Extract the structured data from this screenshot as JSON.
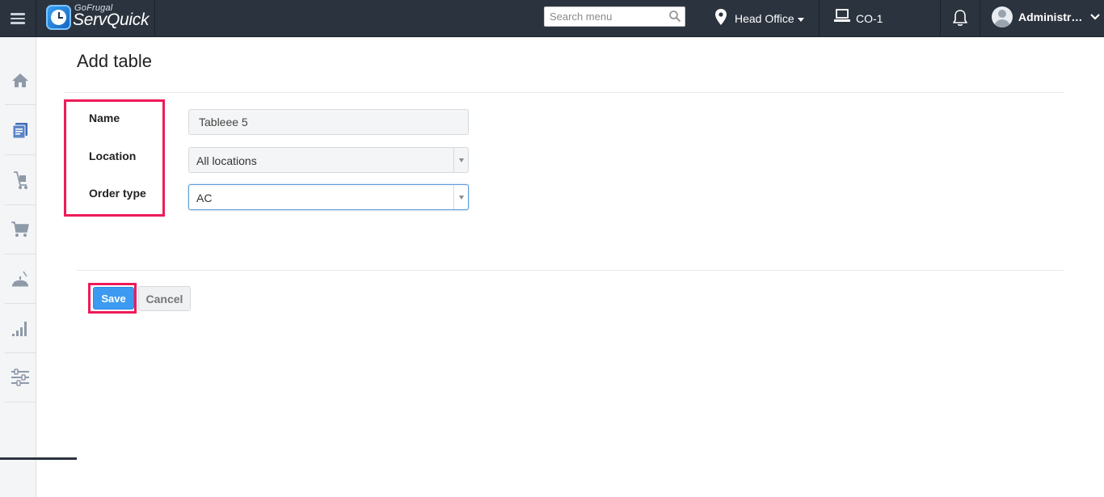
{
  "header": {
    "brand_small": "GoFrugal",
    "brand_name": "ServQuick",
    "search_placeholder": "Search menu",
    "location_label": "Head Office",
    "counter_label": "CO-1",
    "user_label": "Administrator",
    "overflow_dots": "..."
  },
  "sidebar": {
    "items": [
      {
        "icon": "home-icon"
      },
      {
        "icon": "catalog-icon"
      },
      {
        "icon": "inventory-cart-icon"
      },
      {
        "icon": "shopping-cart-icon"
      },
      {
        "icon": "restaurant-icon"
      },
      {
        "icon": "reports-signal-icon"
      },
      {
        "icon": "settings-sliders-icon"
      }
    ]
  },
  "main": {
    "title": "Add table",
    "fields": {
      "name_label": "Name",
      "name_value": "Tableee 5",
      "location_label": "Location",
      "location_value": "All locations",
      "order_type_label": "Order type",
      "order_type_value": "AC"
    },
    "buttons": {
      "save_label": "Save",
      "cancel_label": "Cancel"
    }
  },
  "colors": {
    "topbar": "#2b333e",
    "highlight": "#ee1b59",
    "primary_button": "#3c9bf0"
  }
}
